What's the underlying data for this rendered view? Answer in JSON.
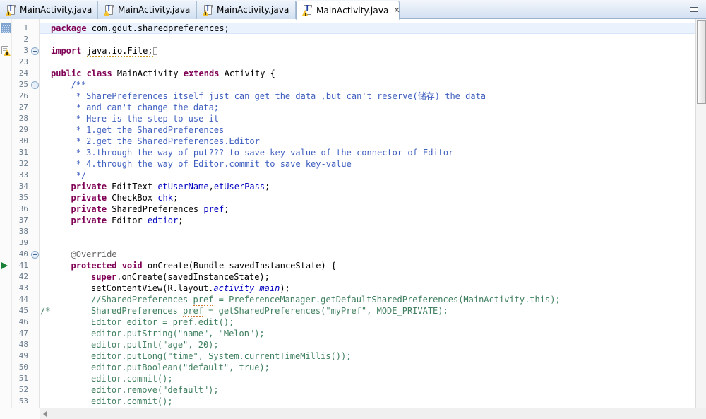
{
  "window": {
    "minimize_label": "Minimize"
  },
  "tabs": [
    {
      "label": "MainActivity.java",
      "icon": "java-file-warning-icon",
      "active": false,
      "close": ""
    },
    {
      "label": "MainActivity.java",
      "icon": "java-file-warning-icon",
      "active": false,
      "close": ""
    },
    {
      "label": "MainActivity.java",
      "icon": "java-file-warning-icon",
      "active": false,
      "close": ""
    },
    {
      "label": "MainActivity.java",
      "icon": "java-file-warning-icon",
      "active": true,
      "close": "✕"
    }
  ],
  "editor": {
    "lines": [
      {
        "num": "1",
        "indent": 0,
        "highlight": true,
        "annot": "changed-line-marker",
        "fold": "",
        "tokens": [
          {
            "t": "package",
            "c": "kw"
          },
          {
            "t": " com.gdut.sharedpreferences;",
            "c": "plain"
          }
        ]
      },
      {
        "num": "2",
        "indent": 0,
        "highlight": false,
        "annot": "",
        "fold": "",
        "tokens": []
      },
      {
        "num": "3",
        "indent": 0,
        "highlight": false,
        "annot": "unused-import-warning-icon",
        "fold": "plus",
        "tokens": [
          {
            "t": "import",
            "c": "kw"
          },
          {
            "t": " ",
            "c": "plain"
          },
          {
            "t": "java.io.File;",
            "c": "plain",
            "u": "warn"
          },
          {
            "t": "",
            "c": "caret"
          }
        ]
      },
      {
        "num": "23",
        "indent": 0,
        "highlight": false,
        "annot": "",
        "fold": "",
        "tokens": []
      },
      {
        "num": "24",
        "indent": 0,
        "highlight": false,
        "annot": "",
        "fold": "",
        "tokens": [
          {
            "t": "public class",
            "c": "kw"
          },
          {
            "t": " MainActivity ",
            "c": "plain"
          },
          {
            "t": "extends",
            "c": "kw"
          },
          {
            "t": " Activity {",
            "c": "plain"
          }
        ]
      },
      {
        "num": "25",
        "indent": 1,
        "highlight": false,
        "annot": "",
        "fold": "minus",
        "tokens": [
          {
            "t": "/**",
            "c": "doc"
          }
        ]
      },
      {
        "num": "26",
        "indent": 1,
        "highlight": false,
        "annot": "",
        "fold": "line",
        "tokens": [
          {
            "t": " * SharePreferences itself just can get the data ,but can't reserve(储存) the data",
            "c": "doc"
          }
        ]
      },
      {
        "num": "27",
        "indent": 1,
        "highlight": false,
        "annot": "",
        "fold": "line",
        "tokens": [
          {
            "t": " * and can't change the data;",
            "c": "doc"
          }
        ]
      },
      {
        "num": "28",
        "indent": 1,
        "highlight": false,
        "annot": "",
        "fold": "line",
        "tokens": [
          {
            "t": " * Here is the step to use it",
            "c": "doc"
          }
        ]
      },
      {
        "num": "29",
        "indent": 1,
        "highlight": false,
        "annot": "",
        "fold": "line",
        "tokens": [
          {
            "t": " * 1.get the SharedPreferences",
            "c": "doc"
          }
        ]
      },
      {
        "num": "30",
        "indent": 1,
        "highlight": false,
        "annot": "",
        "fold": "line",
        "tokens": [
          {
            "t": " * 2.get the SharedPreferences.Editor",
            "c": "doc"
          }
        ]
      },
      {
        "num": "31",
        "indent": 1,
        "highlight": false,
        "annot": "",
        "fold": "line",
        "tokens": [
          {
            "t": " * 3.through the way of put??? to save key-value of the connector of Editor",
            "c": "doc"
          }
        ]
      },
      {
        "num": "32",
        "indent": 1,
        "highlight": false,
        "annot": "",
        "fold": "line",
        "tokens": [
          {
            "t": " * 4.through the way of Editor.commit to save key-value",
            "c": "doc"
          }
        ]
      },
      {
        "num": "33",
        "indent": 1,
        "highlight": false,
        "annot": "",
        "fold": "line",
        "tokens": [
          {
            "t": " */",
            "c": "doc"
          }
        ]
      },
      {
        "num": "34",
        "indent": 1,
        "highlight": false,
        "annot": "",
        "fold": "",
        "tokens": [
          {
            "t": "private",
            "c": "kw"
          },
          {
            "t": " EditText ",
            "c": "plain"
          },
          {
            "t": "etUserName",
            "c": "fld"
          },
          {
            "t": ",",
            "c": "plain"
          },
          {
            "t": "etUserPass",
            "c": "fld"
          },
          {
            "t": ";",
            "c": "plain"
          }
        ]
      },
      {
        "num": "35",
        "indent": 1,
        "highlight": false,
        "annot": "",
        "fold": "",
        "tokens": [
          {
            "t": "private",
            "c": "kw"
          },
          {
            "t": " CheckBox ",
            "c": "plain"
          },
          {
            "t": "chk",
            "c": "fld"
          },
          {
            "t": ";",
            "c": "plain"
          }
        ]
      },
      {
        "num": "36",
        "indent": 1,
        "highlight": false,
        "annot": "",
        "fold": "",
        "tokens": [
          {
            "t": "private",
            "c": "kw"
          },
          {
            "t": " SharedPreferences ",
            "c": "plain"
          },
          {
            "t": "pref",
            "c": "fld"
          },
          {
            "t": ";",
            "c": "plain"
          }
        ]
      },
      {
        "num": "37",
        "indent": 1,
        "highlight": false,
        "annot": "",
        "fold": "",
        "tokens": [
          {
            "t": "private",
            "c": "kw"
          },
          {
            "t": " Editor ",
            "c": "plain"
          },
          {
            "t": "edtior",
            "c": "fld"
          },
          {
            "t": ";",
            "c": "plain"
          }
        ]
      },
      {
        "num": "38",
        "indent": 0,
        "highlight": false,
        "annot": "",
        "fold": "",
        "tokens": []
      },
      {
        "num": "39",
        "indent": 0,
        "highlight": false,
        "annot": "",
        "fold": "",
        "tokens": []
      },
      {
        "num": "40",
        "indent": 1,
        "highlight": false,
        "annot": "",
        "fold": "minus",
        "tokens": [
          {
            "t": "@Override",
            "c": "ann"
          }
        ]
      },
      {
        "num": "41",
        "indent": 1,
        "highlight": false,
        "annot": "override-method-arrow",
        "fold": "line",
        "tokens": [
          {
            "t": "protected void",
            "c": "kw"
          },
          {
            "t": " onCreate(Bundle savedInstanceState) {",
            "c": "plain"
          }
        ]
      },
      {
        "num": "42",
        "indent": 2,
        "highlight": false,
        "annot": "",
        "fold": "line",
        "tokens": [
          {
            "t": "super",
            "c": "kw"
          },
          {
            "t": ".onCreate(savedInstanceState);",
            "c": "plain"
          }
        ]
      },
      {
        "num": "43",
        "indent": 2,
        "highlight": false,
        "annot": "",
        "fold": "line",
        "tokens": [
          {
            "t": "setContentView(R.layout.",
            "c": "plain"
          },
          {
            "t": "activity_main",
            "c": "sfld"
          },
          {
            "t": ");",
            "c": "plain"
          }
        ]
      },
      {
        "num": "44",
        "indent": 2,
        "highlight": false,
        "annot": "",
        "fold": "line",
        "tokens": [
          {
            "t": "//SharedPreferences ",
            "c": "cmt"
          },
          {
            "t": "pref",
            "c": "cmt",
            "u": "spell"
          },
          {
            "t": " = PreferenceManager.getDefaultSharedPreferences(MainActivity.this);",
            "c": "cmt"
          }
        ]
      },
      {
        "num": "45",
        "indent": 2,
        "highlight": false,
        "annot": "",
        "fold": "line",
        "prefix": {
          "t": "/*",
          "c": "cmt"
        },
        "tokens": [
          {
            "t": "SharedPreferences ",
            "c": "cmt"
          },
          {
            "t": "pref",
            "c": "cmt",
            "u": "spell"
          },
          {
            "t": " = getSharedPreferences(\"myPref\", MODE_PRIVATE);",
            "c": "cmt"
          }
        ]
      },
      {
        "num": "46",
        "indent": 2,
        "highlight": false,
        "annot": "",
        "fold": "line",
        "tokens": [
          {
            "t": "Editor editor = pref.edit();",
            "c": "cmt"
          }
        ]
      },
      {
        "num": "47",
        "indent": 2,
        "highlight": false,
        "annot": "",
        "fold": "line",
        "tokens": [
          {
            "t": "editor.putString(\"name\", \"Melon\");",
            "c": "cmt"
          }
        ]
      },
      {
        "num": "48",
        "indent": 2,
        "highlight": false,
        "annot": "",
        "fold": "line",
        "tokens": [
          {
            "t": "editor.putInt(\"age\", 20);",
            "c": "cmt"
          }
        ]
      },
      {
        "num": "49",
        "indent": 2,
        "highlight": false,
        "annot": "",
        "fold": "line",
        "tokens": [
          {
            "t": "editor.putLong(\"time\", System.currentTimeMillis());",
            "c": "cmt"
          }
        ]
      },
      {
        "num": "50",
        "indent": 2,
        "highlight": false,
        "annot": "",
        "fold": "line",
        "tokens": [
          {
            "t": "editor.putBoolean(\"default\", true);",
            "c": "cmt"
          }
        ]
      },
      {
        "num": "51",
        "indent": 2,
        "highlight": false,
        "annot": "",
        "fold": "line",
        "tokens": [
          {
            "t": "editor.commit();",
            "c": "cmt"
          }
        ]
      },
      {
        "num": "52",
        "indent": 2,
        "highlight": false,
        "annot": "",
        "fold": "line",
        "tokens": [
          {
            "t": "editor.remove(\"default\");",
            "c": "cmt"
          }
        ]
      },
      {
        "num": "53",
        "indent": 2,
        "highlight": false,
        "annot": "",
        "fold": "line",
        "tokens": [
          {
            "t": "editor.commit();",
            "c": "cmt"
          }
        ]
      }
    ]
  },
  "colors": {
    "keyword": "#7f0055",
    "javadoc": "#3f5fbf",
    "comment": "#3f7f5f",
    "field": "#0000c0",
    "annotation": "#646464",
    "line_highlight": "#eaf2fd",
    "tab_active_bg": "#ffffff"
  }
}
